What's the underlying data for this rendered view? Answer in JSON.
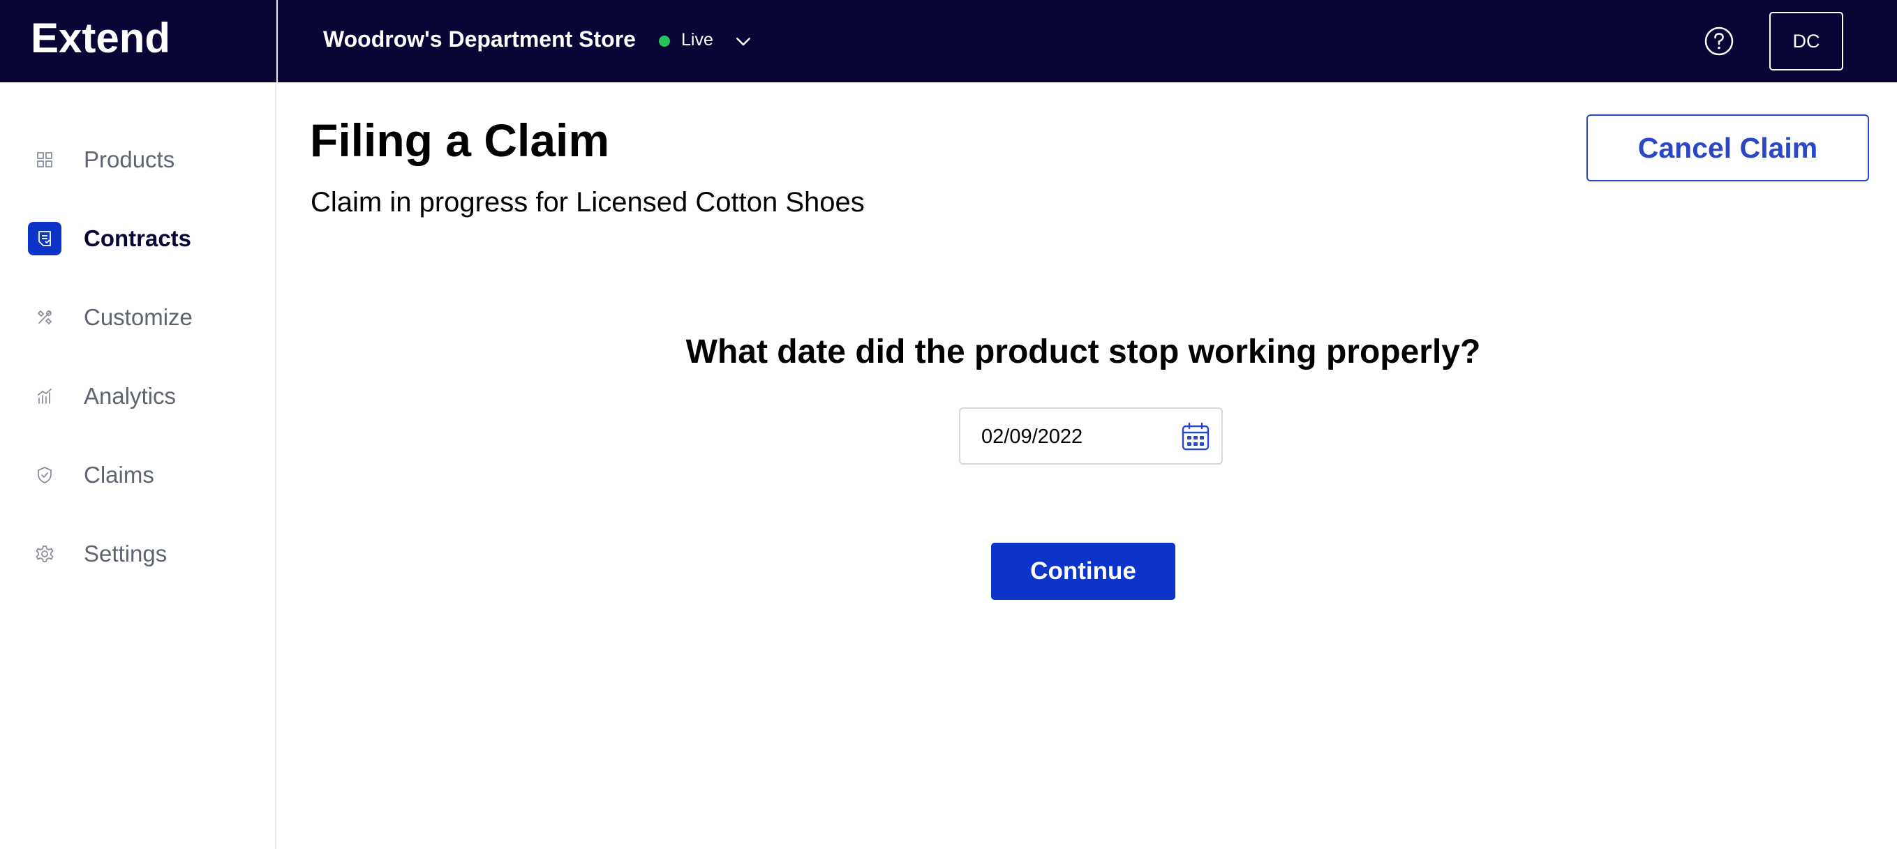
{
  "header": {
    "logo": "Extend",
    "store_name": "Woodrow's Department Store",
    "status": "Live",
    "status_color": "#27c45e",
    "avatar_initials": "DC",
    "background_color": "#090637"
  },
  "sidebar": {
    "items": [
      {
        "label": "Products",
        "icon": "grid-icon",
        "active": false
      },
      {
        "label": "Contracts",
        "icon": "contract-icon",
        "active": true
      },
      {
        "label": "Customize",
        "icon": "tools-icon",
        "active": false
      },
      {
        "label": "Analytics",
        "icon": "chart-icon",
        "active": false
      },
      {
        "label": "Claims",
        "icon": "shield-icon",
        "active": false
      },
      {
        "label": "Settings",
        "icon": "gear-icon",
        "active": false
      }
    ]
  },
  "main": {
    "title": "Filing a Claim",
    "subtitle": "Claim in progress for Licensed Cotton Shoes",
    "cancel_label": "Cancel Claim",
    "question": "What date did the product stop working properly?",
    "date_value": "02/09/2022",
    "continue_label": "Continue",
    "accent_color": "#0d34c9"
  }
}
